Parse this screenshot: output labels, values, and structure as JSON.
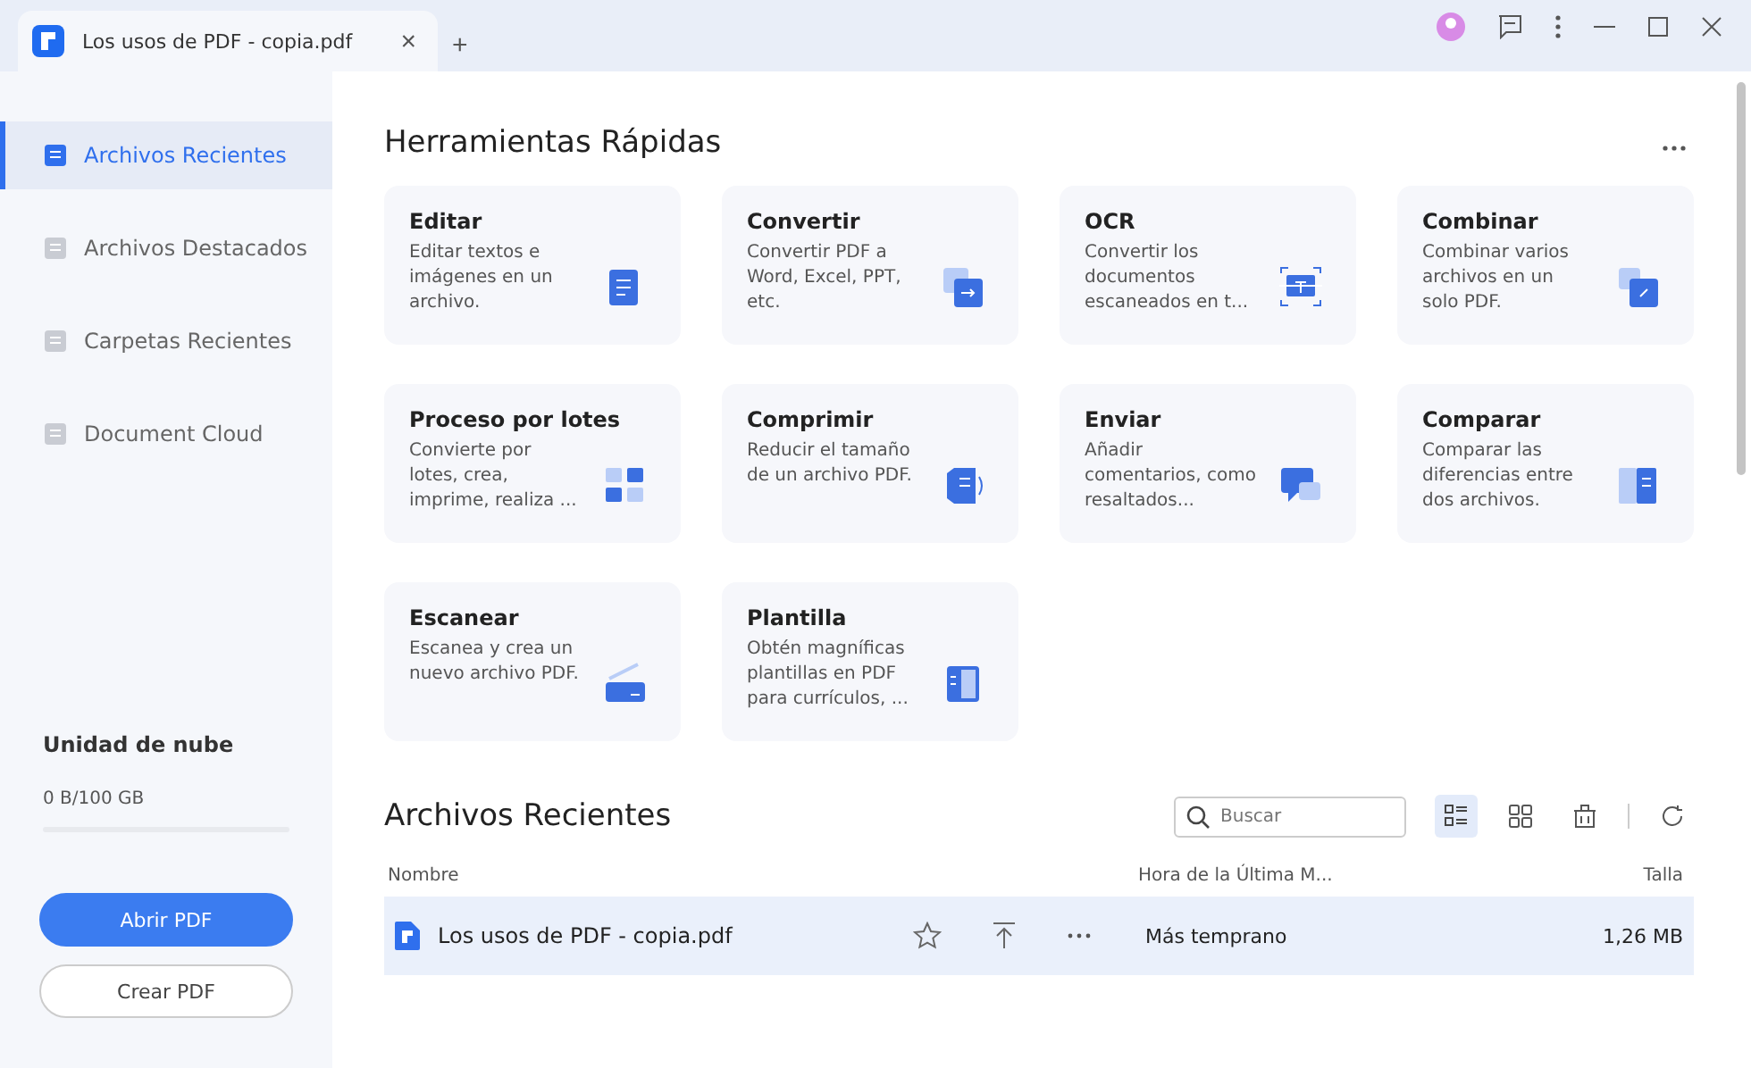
{
  "tab": {
    "title": "Los usos de PDF - copia.pdf",
    "close": "×",
    "new": "+"
  },
  "sidebar": {
    "items": [
      {
        "label": "Archivos Recientes",
        "selected": true
      },
      {
        "label": "Archivos Destacados",
        "selected": false
      },
      {
        "label": "Carpetas Recientes",
        "selected": false
      },
      {
        "label": "Document Cloud",
        "selected": false
      }
    ],
    "cloud": {
      "title": "Unidad de nube",
      "usage": "0 B/100 GB",
      "level": 0
    },
    "buttons": [
      {
        "label": "Abrir PDF",
        "kind": "primary"
      },
      {
        "label": "Crear PDF",
        "kind": "secondary"
      }
    ]
  },
  "quick_tools": {
    "title": "Herramientas Rápidas",
    "tools": [
      {
        "name": "Editar",
        "description": "Editar textos e imágenes en un archivo."
      },
      {
        "name": "Convertir",
        "description": "Convertir PDF a Word, Excel, PPT, etc."
      },
      {
        "name": "OCR",
        "description": "Convertir los documentos escaneados en t..."
      },
      {
        "name": "Combinar",
        "description": "Combinar varios archivos en un solo PDF."
      },
      {
        "name": "Proceso por lotes",
        "description": "Convierte por lotes, crea, imprime, realiza ..."
      },
      {
        "name": "Comprimir",
        "description": "Reducir el tamaño de un archivo PDF."
      },
      {
        "name": "Enviar",
        "description": "Añadir comentarios, como resaltados..."
      },
      {
        "name": "Comparar",
        "description": "Comparar las diferencias entre dos archivos."
      },
      {
        "name": "Escanear",
        "description": "Escanea y crea un nuevo archivo PDF."
      },
      {
        "name": "Plantilla",
        "description": "Obtén magníficas plantillas en PDF para currículos, ..."
      }
    ]
  },
  "recent_files": {
    "title": "Archivos Recientes",
    "search": {
      "placeholder": "Buscar"
    },
    "views": [
      {
        "kind": "list",
        "selected": true
      },
      {
        "kind": "grid",
        "selected": false
      }
    ],
    "columns": [
      "Nombre",
      "Hora de la Última M...",
      "Talla"
    ],
    "rows": [
      {
        "name": "Los usos de PDF - copia.pdf",
        "time": "Más temprano",
        "size": "1,26 MB",
        "selected": true
      }
    ]
  }
}
